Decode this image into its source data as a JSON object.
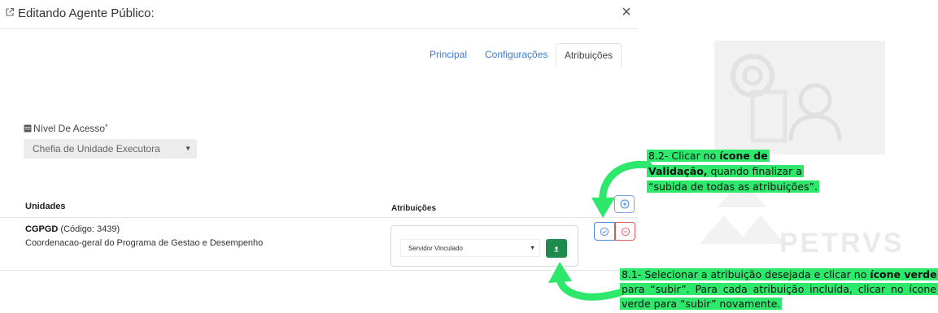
{
  "modal": {
    "title": "Editando Agente Público:",
    "close_label": "×"
  },
  "tabs": [
    {
      "label": "Principal",
      "active": false
    },
    {
      "label": "Configurações",
      "active": false
    },
    {
      "label": "Atribuições",
      "active": true
    }
  ],
  "nivel_acesso": {
    "label": "Nível De Acesso",
    "required_mark": "*",
    "value": "Chefia de Unidade Executora"
  },
  "table": {
    "headers": {
      "unidades": "Unidades",
      "atribuicoes": "Atribuições"
    },
    "rows": [
      {
        "sigla": "CGPGD",
        "codigo": "(Código: 3439)",
        "nome": "Coordenacao-geral do Programa de Gestao e Desempenho",
        "atribuicao_selecionada": "Servidor Vinculado"
      }
    ]
  },
  "icons": {
    "open": "external-link-icon",
    "db": "database-icon",
    "add": "plus-circle-icon",
    "upload": "upload-arrow-icon",
    "validate": "check-circle-icon",
    "remove": "minus-circle-icon"
  },
  "colors": {
    "tab_link": "#3a7bd5",
    "upload_button": "#1e8a4c",
    "validate_border": "#4a86e0",
    "remove_border": "#e05a5a",
    "annotation_highlight": "#2ee86c"
  },
  "watermark": {
    "text": "PETRVS"
  },
  "annotations": {
    "note_82": {
      "prefix": "8.2- Clicar no ",
      "bold": "ícone de Validação,",
      "suffix": " quando finalizar a “subida de todas as atribuições”."
    },
    "note_81": {
      "prefix": "8.1- Selecionar a atribuição desejada e clicar no ",
      "bold": "ícone verde",
      "suffix": " para “subir”. Para cada atribuição incluída, clicar no ícone verde para “subir” novamente."
    }
  }
}
